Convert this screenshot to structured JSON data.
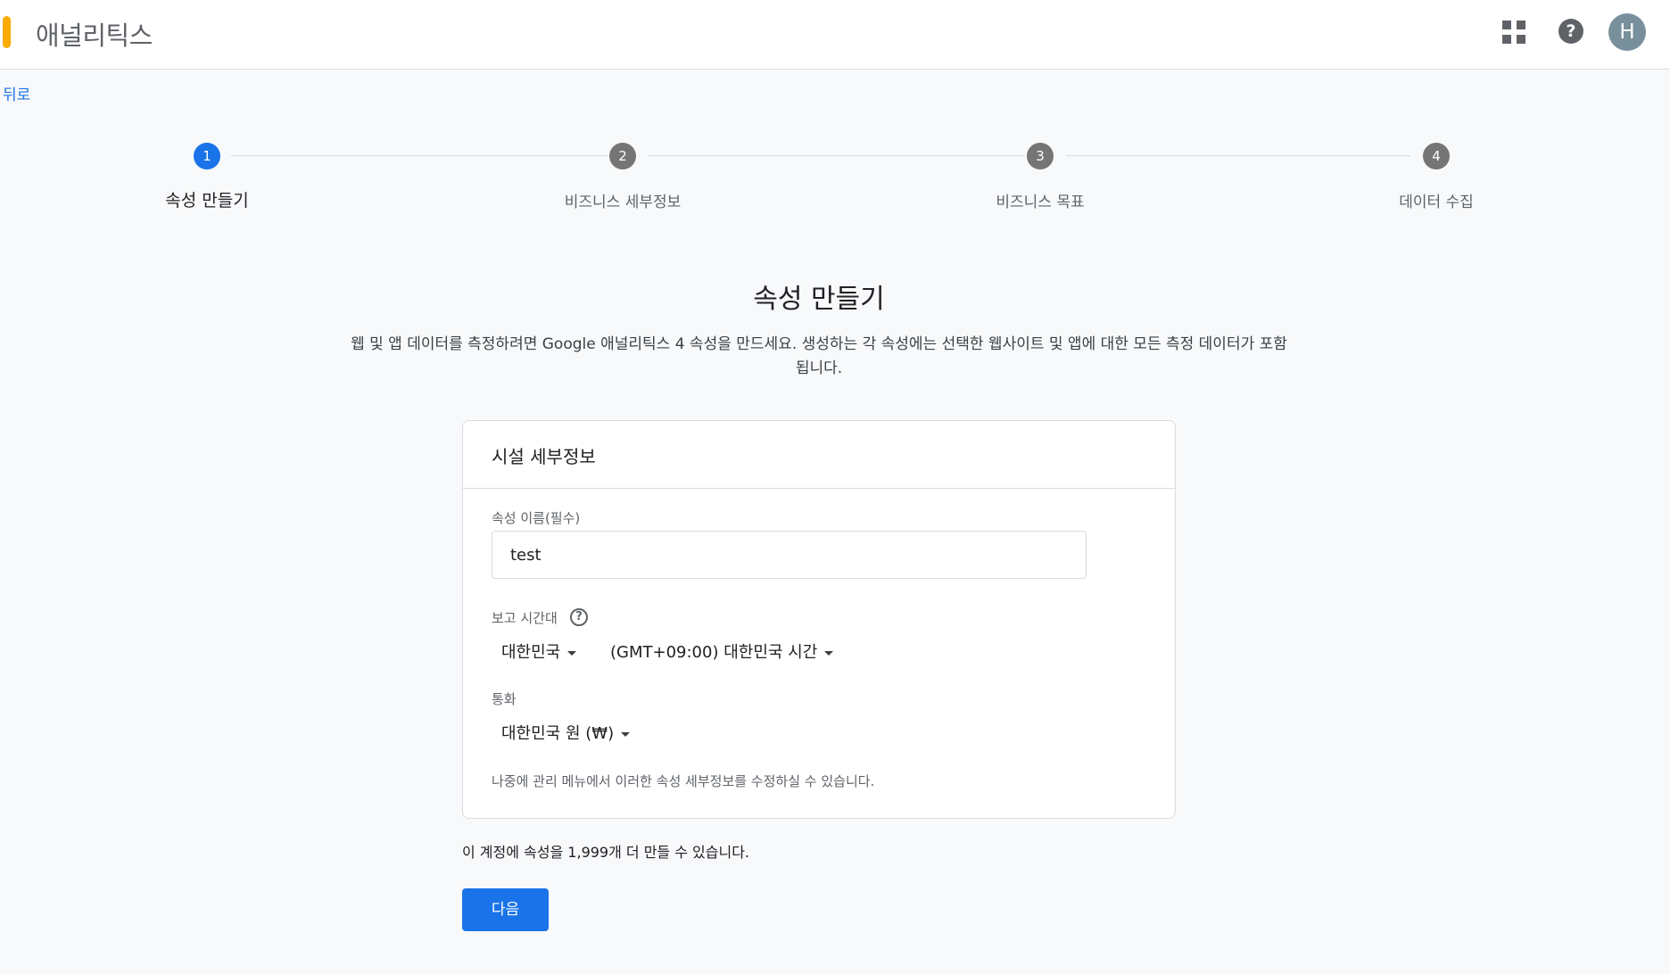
{
  "header": {
    "app_title": "애널리틱스",
    "account_initial": "H",
    "help_glyph": "?",
    "brand_color": "#f9ab00"
  },
  "nav": {
    "back_label": "뒤로"
  },
  "stepper": {
    "steps": [
      {
        "number": "1",
        "label": "속성 만들기",
        "active": true
      },
      {
        "number": "2",
        "label": "비즈니스 세부정보",
        "active": false
      },
      {
        "number": "3",
        "label": "비즈니스 목표",
        "active": false
      },
      {
        "number": "4",
        "label": "데이터 수집",
        "active": false
      }
    ]
  },
  "main": {
    "title": "속성 만들기",
    "description": "웹 및 앱 데이터를 측정하려면 Google 애널리틱스 4 속성을 만드세요. 생성하는 각 속성에는 선택한 웹사이트 및 앱에 대한 모든 측정 데이터가 포함됩니다."
  },
  "card": {
    "title": "시설 세부정보",
    "property_name": {
      "label": "속성 이름(필수)",
      "value": "test"
    },
    "reporting_timezone": {
      "label": "보고 시간대",
      "help_glyph": "?",
      "country": "대한민국",
      "timezone": "(GMT+09:00) 대한민국 시간"
    },
    "currency": {
      "label": "통화",
      "value": "대한민국 원 (₩)"
    },
    "note": "나중에 관리 메뉴에서 이러한 속성 세부정보를 수정하실 수 있습니다."
  },
  "footer": {
    "quota_text": "이 계정에 속성을 1,999개 더 만들 수 있습니다.",
    "next_label": "다음"
  },
  "colors": {
    "accent": "#1a73e8",
    "inactive_step": "#757575"
  }
}
